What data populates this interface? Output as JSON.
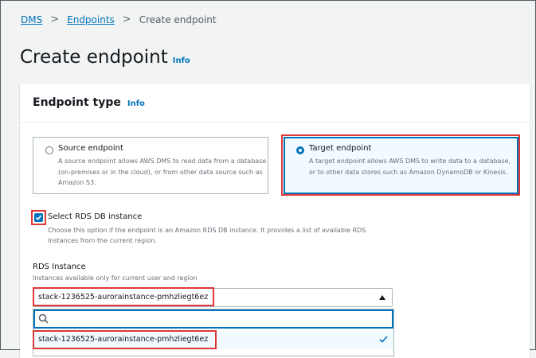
{
  "breadcrumb": {
    "items": [
      "DMS",
      "Endpoints"
    ],
    "separator": ">",
    "current": "Create endpoint"
  },
  "page": {
    "title": "Create endpoint",
    "info": "Info"
  },
  "section": {
    "title": "Endpoint type",
    "info": "Info",
    "source": {
      "label": "Source endpoint",
      "description": "A source endpoint allows AWS DMS to read data from a database (on-premises or in the cloud), or from other data source such as Amazon S3.",
      "selected": false
    },
    "target": {
      "label": "Target endpoint",
      "description": "A target endpoint allows AWS DMS to write data to a database, or to other data stores such as Amazon DynamoDB or Kinesis.",
      "selected": true
    },
    "rds_checkbox": {
      "label": "Select RDS DB instance",
      "description": "Choose this option if the endpoint is an Amazon RDS DB instance. It provides a list of available RDS Instances from the current region.",
      "checked": true
    },
    "rds_instance": {
      "label": "RDS Instance",
      "description": "Instances available only for current user and region",
      "value": "stack-1236525-aurorainstance-pmhzliegt6ez",
      "filter_placeholder": "",
      "options": [
        "stack-1236525-aurorainstance-pmhzliegt6ez"
      ]
    }
  },
  "colors": {
    "accent": "#0073bb",
    "highlight": "#df3737",
    "text": "#16191f",
    "muted": "#687078"
  }
}
